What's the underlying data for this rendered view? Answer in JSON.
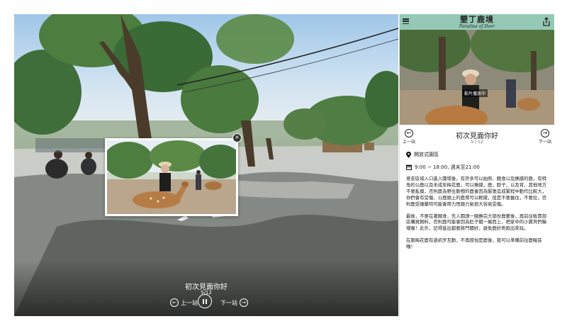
{
  "viewer": {
    "caption_title": "初次見面你好",
    "caption_count": "5/12",
    "prev_label": "上一站",
    "next_label": "下一站",
    "pause_icon": "pause-icon"
  },
  "panel": {
    "brand_zh": "墾丁鹿境",
    "brand_en": "Paradise of Deer",
    "playing_badge": "影片播放中",
    "card": {
      "title": "初次見面你好",
      "count": "5 / 12",
      "prev_label": "上一站",
      "next_label": "下一站",
      "location": "開放式園區",
      "hours": "9:00 ~ 18:00, 週末至21:00",
      "paragraphs": [
        "意安區域入口進入園場後，有許多可以拍照、餵食以及撫摸的鹿，有特角的公鹿以及未成年梅花鹿，可以撫摸，鹿，脖子，以及背，其他地方不要亂摸，否則鹿為野生動物的鹿會因為緊張造成緊程中動作比較大，你們會有受傷，公鹿頭上的鹿茸可以輕摸，但是不要握住，不要拉，否則鹿受撞擊時可能會用力甩頭力氣很大容易受傷。",
        "最後，不要在著餵食，先入園請一圈撫完大部份鹿奢後，再前往販賣部區購買飼料，否則鹿可能會因為肚子餓一擁而上，把家中的小寶貝們嚇壞喔！此外，記得進出都要將門關好，避免鹿好奇跑出來玩。",
        "在跟梅花鹿有過初步互動，不再擔怕是鹿後，我可以準備前往鹿喔區囉！"
      ]
    }
  }
}
